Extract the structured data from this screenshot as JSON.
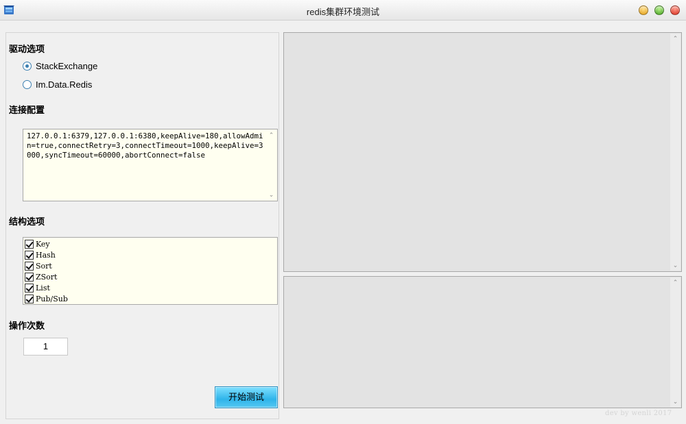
{
  "window": {
    "title": "redis集群环境测试",
    "icons": [
      "redis-logo-icon",
      "minimize-icon",
      "maximize-icon",
      "close-icon"
    ]
  },
  "driver": {
    "label": "驱动选项",
    "options": [
      {
        "label": "StackExchange",
        "checked": true
      },
      {
        "label": "Im.Data.Redis",
        "checked": false
      }
    ]
  },
  "connection": {
    "label": "连接配置",
    "value": "127.0.0.1:6379,127.0.0.1:6380,keepAlive=180,allowAdmin=true,connectRetry=3,connectTimeout=1000,keepAlive=3000,syncTimeout=60000,abortConnect=false"
  },
  "structure": {
    "label": "结构选项",
    "items": [
      {
        "label": "Key",
        "checked": true
      },
      {
        "label": "Hash",
        "checked": true
      },
      {
        "label": "Sort",
        "checked": true
      },
      {
        "label": "ZSort",
        "checked": true
      },
      {
        "label": "List",
        "checked": true
      },
      {
        "label": "Pub/Sub",
        "checked": true
      }
    ]
  },
  "operations": {
    "label": "操作次数",
    "value": "1"
  },
  "actions": {
    "start_label": "开始测试"
  },
  "output": {
    "top_text": "",
    "bottom_text": ""
  },
  "footer": {
    "watermark": "dev by wenli 2017"
  },
  "colors": {
    "accent": "#2fb4ea",
    "input_background": "#fffff0",
    "output_background": "#e3e3e3"
  }
}
